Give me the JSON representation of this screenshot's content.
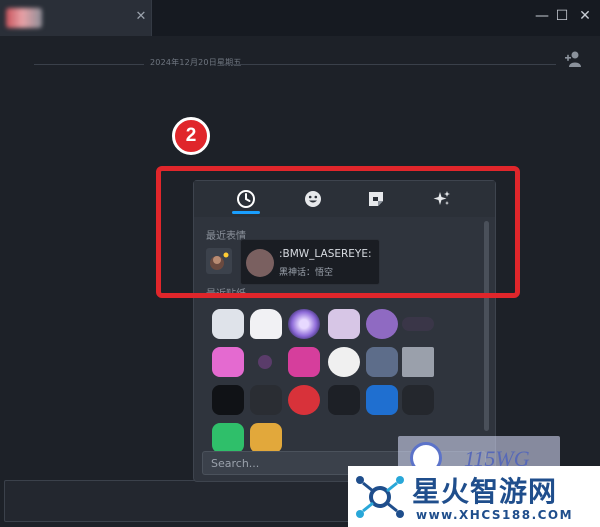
{
  "titlebar": {
    "tab_close": "✕",
    "minimize": "—",
    "maximize": "☐",
    "close": "✕"
  },
  "chat": {
    "date_separator": "2024年12月20日星期五"
  },
  "step_badge": "2",
  "picker": {
    "tabs": [
      {
        "icon": "clock-icon",
        "active": true
      },
      {
        "icon": "smiley-icon",
        "active": false
      },
      {
        "icon": "sticker-icon",
        "active": false
      },
      {
        "icon": "sparkle-icon",
        "active": false
      }
    ],
    "recent_emotes_label": "最近表情",
    "recent_stickers_label": "最近贴纸",
    "search_placeholder": "Search..."
  },
  "tooltip": {
    "name": ":BMW_LASEREYE:",
    "game": "黑神话：悟空"
  },
  "watermarks": {
    "brand_small": "115WG",
    "title": "星火智游网",
    "url": "www.XHCS188.COM"
  },
  "colors": {
    "accent": "#1a9fff",
    "highlight": "#e0262b",
    "background": "#1d2128",
    "panel": "#2f343d"
  }
}
